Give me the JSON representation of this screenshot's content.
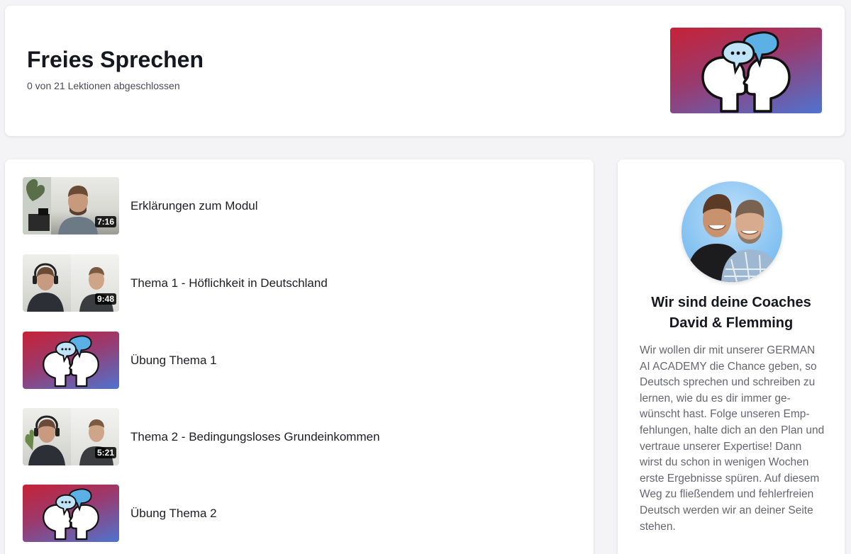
{
  "course": {
    "title": "Freies Sprechen",
    "progress_text": "0 von 21 Lektionen abgeschlossen",
    "thumbnail_icon": "speaking-heads-chat-icon"
  },
  "lessons": [
    {
      "title": "Erklärungen zum Modul",
      "duration": "7:16",
      "thumb": "video-single-speaker"
    },
    {
      "title": "Thema 1 - Höflichkeit in Deutschland",
      "duration": "9:48",
      "thumb": "video-two-speakers"
    },
    {
      "title": "Übung Thema 1",
      "duration": "",
      "thumb": "speaking-heads-chat-icon"
    },
    {
      "title": "Thema 2 - Bedingungsloses Grundeinkommen",
      "duration": "5:21",
      "thumb": "video-two-speakers"
    },
    {
      "title": "Übung Thema 2",
      "duration": "",
      "thumb": "speaking-heads-chat-icon"
    }
  ],
  "coaches": {
    "heading_line1": "Wir sind deine Coaches",
    "heading_line2": "David & Flemming",
    "text": "Wir wollen dir mit unserer GERMAN AI ACADEMY die Chance geben, so Deutsch sprechen und schreiben zu lernen, wie du es dir immer ge­wünscht hast. Folge unseren Emp­fehlungen, halte dich an den Plan und vertraue unserer Expertise! Dann wirst du schon in wenigen Wochen erste Ergebnisse spüren. Auf diesem Weg zu fließendem und fehlerfreien Deutsch werden wir an deiner Seite stehen."
  },
  "colors": {
    "gradient_top": "#c62236",
    "gradient_bottom": "#4f73cf",
    "bubble_blue": "#5bb0e6",
    "avatar_bg": "#7fbff0"
  }
}
